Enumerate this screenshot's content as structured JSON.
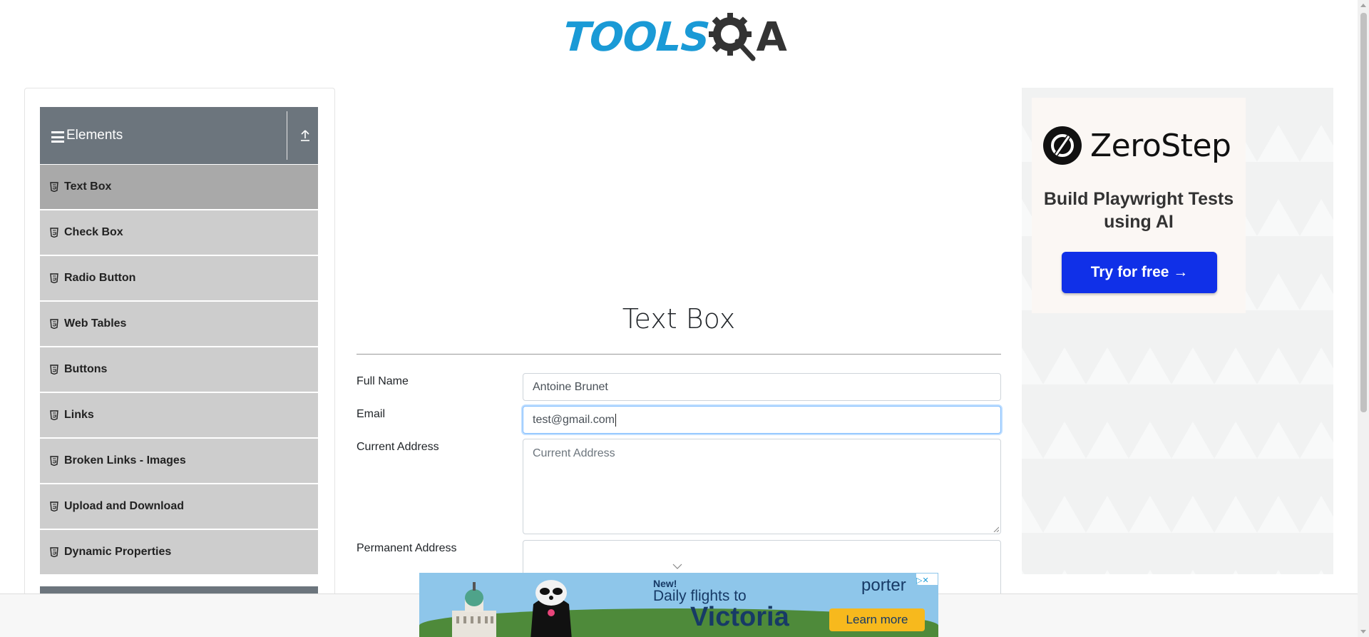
{
  "header": {
    "logo_text_left": "TOOLS",
    "logo_text_right": "A"
  },
  "sidebar": {
    "group_title": "Elements",
    "items": [
      {
        "label": "Text Box",
        "active": true
      },
      {
        "label": "Check Box",
        "active": false
      },
      {
        "label": "Radio Button",
        "active": false
      },
      {
        "label": "Web Tables",
        "active": false
      },
      {
        "label": "Buttons",
        "active": false
      },
      {
        "label": "Links",
        "active": false
      },
      {
        "label": "Broken Links - Images",
        "active": false
      },
      {
        "label": "Upload and Download",
        "active": false
      },
      {
        "label": "Dynamic Properties",
        "active": false
      }
    ]
  },
  "main": {
    "title": "Text Box",
    "form": {
      "full_name_label": "Full Name",
      "full_name_value": "Antoine Brunet",
      "email_label": "Email",
      "email_value": "test@gmail.com",
      "current_address_label": "Current Address",
      "current_address_placeholder": "Current Address",
      "permanent_address_label": "Permanent Address"
    }
  },
  "right_ad": {
    "brand": "ZeroStep",
    "tagline": "Build Playwright Tests using AI",
    "cta": "Try for free →"
  },
  "bottom_ad": {
    "new": "New!",
    "line": "Daily flights to",
    "destination": "Victoria",
    "brand": "porter",
    "cta": "Learn more"
  },
  "colors": {
    "logo_blue": "#1a9ad6",
    "sidebar_header": "#6c757d",
    "menu_item": "#cdcdcd",
    "menu_item_active": "#a9a9a9",
    "cta_blue": "#1030e8",
    "ad_yellow": "#f7b91d"
  }
}
